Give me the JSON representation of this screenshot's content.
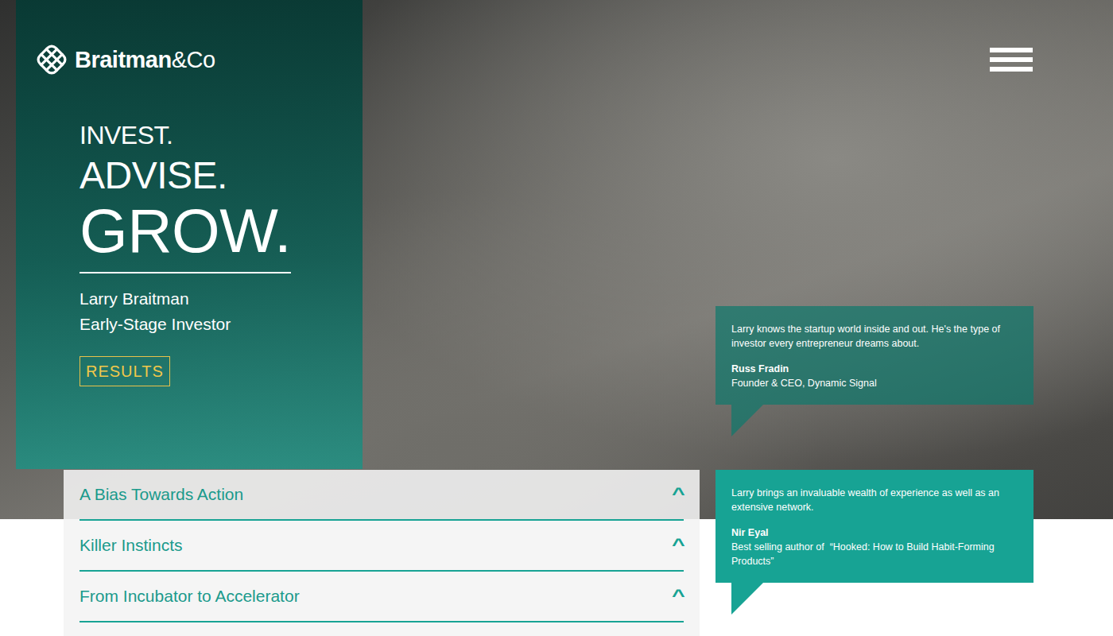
{
  "logo": {
    "name": "Braitman",
    "suffix": "&Co"
  },
  "hero": {
    "headline": [
      "INVEST.",
      "ADVISE.",
      "GROW."
    ],
    "person": "Larry Braitman",
    "role": "Early-Stage Investor",
    "button": "RESULTS"
  },
  "accordion": {
    "items": [
      {
        "title": "A Bias Towards Action",
        "icon": "^",
        "expanded": false
      },
      {
        "title": "Killer Instincts",
        "icon": "^",
        "expanded": false
      },
      {
        "title": "From Incubator to Accelerator",
        "icon": "^",
        "expanded": false
      }
    ]
  },
  "testimonials": [
    {
      "quote": "Larry knows the startup world inside and out. He's the type of investor every entrepreneur dreams about.",
      "author": "Russ Fradin",
      "role": "Founder & CEO, Dynamic Signal"
    },
    {
      "quote": "Larry brings an invaluable wealth of experience as well as an extensive network.",
      "author": "Nir Eyal",
      "role": "Best selling author of  “Hooked: How to Build Habit-Forming Products”"
    }
  ]
}
